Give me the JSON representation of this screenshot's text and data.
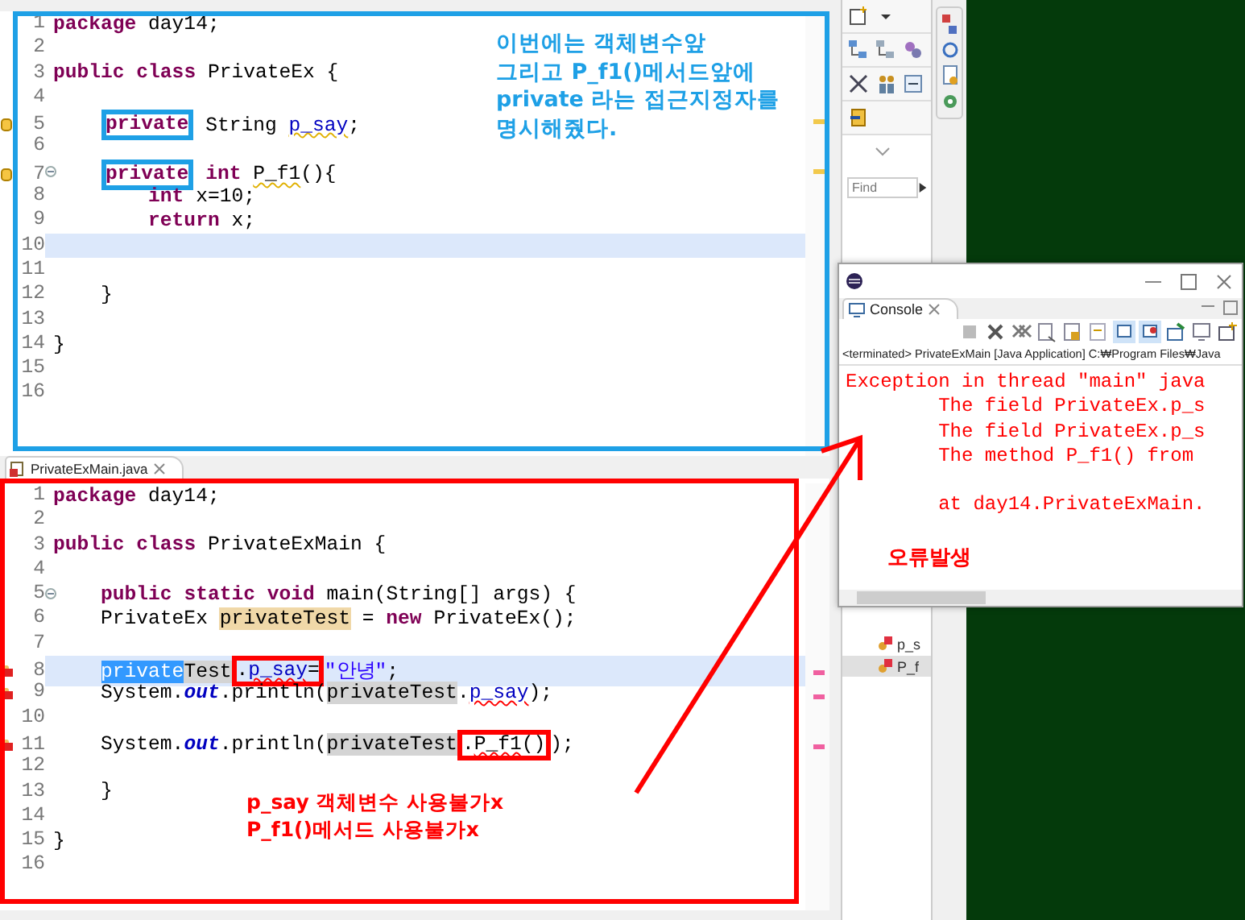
{
  "editors": [
    {
      "color": "#1ea0e6",
      "note": "이번에는 객체변수앞\n그리고 P_f1()메서드앞에\nprivate 라는 접근지정자를\n명시해줬다.",
      "lines": [
        {
          "number": "1",
          "current": false,
          "tokens": [
            {
              "text": "package",
              "kind": "keyword"
            },
            {
              "text": " day14;",
              "kind": "plain"
            }
          ]
        },
        {
          "number": "2",
          "current": false
        },
        {
          "number": "3",
          "current": false,
          "tokens": [
            {
              "text": "public",
              "kind": "keyword"
            },
            {
              "text": " class",
              "kind": "keyword"
            },
            {
              "text": " PrivateEx {",
              "kind": "plain"
            }
          ]
        },
        {
          "number": "4",
          "current": false
        },
        {
          "number": "5",
          "current": false,
          "warning": true,
          "tokens": [
            {
              "text": "    private",
              "kind": "keyword",
              "boxed": true
            },
            {
              "text": " String ",
              "kind": "plain"
            },
            {
              "text": "p_say",
              "kind": "field",
              "warning": true
            },
            {
              "text": ";",
              "kind": "plain"
            }
          ]
        },
        {
          "number": "6",
          "current": false
        },
        {
          "number": "7",
          "current": false,
          "warning": true,
          "fold": true,
          "tokens": [
            {
              "text": "    private",
              "kind": "keyword",
              "boxed": true
            },
            {
              "text": " int",
              "kind": "keyword"
            },
            {
              "text": " P_f1",
              "kind": "plain",
              "warning": true
            },
            {
              "text": "(){",
              "kind": "plain"
            }
          ]
        },
        {
          "number": "8",
          "current": false,
          "tokens": [
            {
              "text": "        int",
              "kind": "keyword"
            },
            {
              "text": " x=10;",
              "kind": "plain"
            }
          ]
        },
        {
          "number": "9",
          "current": false,
          "tokens": [
            {
              "text": "        return",
              "kind": "keyword"
            },
            {
              "text": " x;",
              "kind": "plain"
            }
          ]
        },
        {
          "number": "10",
          "current": true
        },
        {
          "number": "11",
          "current": false
        },
        {
          "number": "12",
          "current": false,
          "tokens": [
            {
              "text": "    }",
              "kind": "plain"
            }
          ]
        },
        {
          "number": "13",
          "current": false
        },
        {
          "number": "14",
          "current": false,
          "tokens": [
            {
              "text": "}",
              "kind": "plain"
            }
          ]
        },
        {
          "number": "15",
          "current": false
        },
        {
          "number": "16",
          "current": false
        }
      ]
    },
    {
      "tab": "PrivateExMain.java",
      "color": "#ff0000",
      "note": "p_say 객체변수 사용불가x\nP_f1()메서드 사용불가x",
      "lines": [
        {
          "number": "1",
          "current": false,
          "tokens": [
            {
              "text": "package",
              "kind": "keyword"
            },
            {
              "text": " day14;",
              "kind": "plain"
            }
          ]
        },
        {
          "number": "2",
          "current": false
        },
        {
          "number": "3",
          "current": false,
          "tokens": [
            {
              "text": "public",
              "kind": "keyword"
            },
            {
              "text": " class",
              "kind": "keyword"
            },
            {
              "text": " PrivateExMain {",
              "kind": "plain"
            }
          ]
        },
        {
          "number": "4",
          "current": false
        },
        {
          "number": "5",
          "current": false,
          "fold": true,
          "tokens": [
            {
              "text": "    public",
              "kind": "keyword"
            },
            {
              "text": " static",
              "kind": "keyword"
            },
            {
              "text": " void",
              "kind": "keyword"
            },
            {
              "text": " main(String[] args) {",
              "kind": "plain"
            }
          ]
        },
        {
          "number": "6",
          "current": false,
          "tokens": [
            {
              "text": "    PrivateEx ",
              "kind": "plain"
            },
            {
              "text": "privateTest",
              "kind": "write-occurrence"
            },
            {
              "text": " = ",
              "kind": "plain"
            },
            {
              "text": "new",
              "kind": "keyword"
            },
            {
              "text": " PrivateEx();",
              "kind": "plain"
            }
          ]
        },
        {
          "number": "7",
          "current": false
        },
        {
          "number": "8",
          "current": true,
          "error": true,
          "tokens": [
            {
              "text": "    private",
              "kind": "selection"
            },
            {
              "text": "Test",
              "kind": "read-occurrence"
            },
            {
              "text": ".",
              "kind": "plain",
              "boxed": true
            },
            {
              "text": "p_say",
              "kind": "field",
              "error": true,
              "boxed": true
            },
            {
              "text": "=",
              "kind": "plain",
              "boxed": true
            },
            {
              "text": "\"안녕\"",
              "kind": "string"
            },
            {
              "text": ";",
              "kind": "plain"
            }
          ]
        },
        {
          "number": "9",
          "current": false,
          "error": true,
          "tokens": [
            {
              "text": "    System.",
              "kind": "plain"
            },
            {
              "text": "out",
              "kind": "static"
            },
            {
              "text": ".println(",
              "kind": "plain"
            },
            {
              "text": "privateTest",
              "kind": "read-occurrence"
            },
            {
              "text": ".",
              "kind": "plain"
            },
            {
              "text": "p_say",
              "kind": "field",
              "error": true
            },
            {
              "text": ");",
              "kind": "plain"
            }
          ]
        },
        {
          "number": "10",
          "current": false
        },
        {
          "number": "11",
          "current": false,
          "error": true,
          "tokens": [
            {
              "text": "    System.",
              "kind": "plain"
            },
            {
              "text": "out",
              "kind": "static"
            },
            {
              "text": ".println(",
              "kind": "plain"
            },
            {
              "text": "privateTest",
              "kind": "read-occurrence"
            },
            {
              "text": ".",
              "kind": "plain",
              "boxed": true
            },
            {
              "text": "P_f1",
              "kind": "plain",
              "error": true,
              "boxed": true
            },
            {
              "text": "()",
              "kind": "plain",
              "boxed": true
            },
            {
              "text": ");",
              "kind": "plain"
            }
          ]
        },
        {
          "number": "12",
          "current": false
        },
        {
          "number": "13",
          "current": false,
          "tokens": [
            {
              "text": "    }",
              "kind": "plain"
            }
          ]
        },
        {
          "number": "14",
          "current": false
        },
        {
          "number": "15",
          "current": false,
          "tokens": [
            {
              "text": "}",
              "kind": "plain"
            }
          ]
        },
        {
          "number": "16",
          "current": false
        }
      ]
    }
  ],
  "outline": {
    "find": {
      "placeholder": "Find"
    },
    "items": [
      {
        "label": "p_s",
        "selected": false
      },
      {
        "label": "P_f",
        "selected": true
      }
    ]
  },
  "console": {
    "tab": "Console",
    "header": "<terminated> PrivateExMain [Java Application] C:₩Program Files₩Java",
    "output": [
      "Exception in thread \"main\" java",
      "        The field PrivateEx.p_s",
      "        The field PrivateEx.p_s",
      "        The method P_f1() from"
    ],
    "trace": [
      "        at day14.PrivateExMain."
    ],
    "note": "오류발생"
  }
}
